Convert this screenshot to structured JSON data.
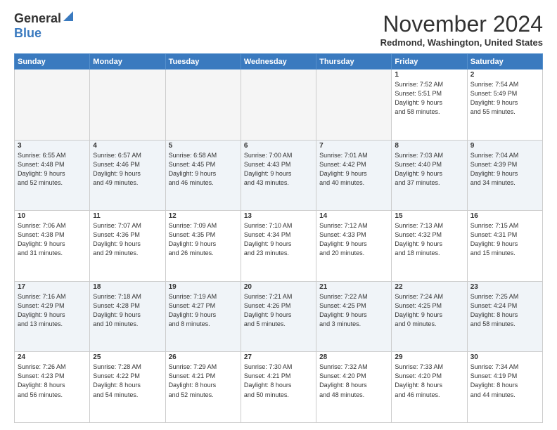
{
  "logo": {
    "line1": "General",
    "line2": "Blue"
  },
  "title": "November 2024",
  "location": "Redmond, Washington, United States",
  "days_of_week": [
    "Sunday",
    "Monday",
    "Tuesday",
    "Wednesday",
    "Thursday",
    "Friday",
    "Saturday"
  ],
  "weeks": [
    [
      {
        "day": "",
        "info": ""
      },
      {
        "day": "",
        "info": ""
      },
      {
        "day": "",
        "info": ""
      },
      {
        "day": "",
        "info": ""
      },
      {
        "day": "",
        "info": ""
      },
      {
        "day": "1",
        "info": "Sunrise: 7:52 AM\nSunset: 5:51 PM\nDaylight: 9 hours\nand 58 minutes."
      },
      {
        "day": "2",
        "info": "Sunrise: 7:54 AM\nSunset: 5:49 PM\nDaylight: 9 hours\nand 55 minutes."
      }
    ],
    [
      {
        "day": "3",
        "info": "Sunrise: 6:55 AM\nSunset: 4:48 PM\nDaylight: 9 hours\nand 52 minutes."
      },
      {
        "day": "4",
        "info": "Sunrise: 6:57 AM\nSunset: 4:46 PM\nDaylight: 9 hours\nand 49 minutes."
      },
      {
        "day": "5",
        "info": "Sunrise: 6:58 AM\nSunset: 4:45 PM\nDaylight: 9 hours\nand 46 minutes."
      },
      {
        "day": "6",
        "info": "Sunrise: 7:00 AM\nSunset: 4:43 PM\nDaylight: 9 hours\nand 43 minutes."
      },
      {
        "day": "7",
        "info": "Sunrise: 7:01 AM\nSunset: 4:42 PM\nDaylight: 9 hours\nand 40 minutes."
      },
      {
        "day": "8",
        "info": "Sunrise: 7:03 AM\nSunset: 4:40 PM\nDaylight: 9 hours\nand 37 minutes."
      },
      {
        "day": "9",
        "info": "Sunrise: 7:04 AM\nSunset: 4:39 PM\nDaylight: 9 hours\nand 34 minutes."
      }
    ],
    [
      {
        "day": "10",
        "info": "Sunrise: 7:06 AM\nSunset: 4:38 PM\nDaylight: 9 hours\nand 31 minutes."
      },
      {
        "day": "11",
        "info": "Sunrise: 7:07 AM\nSunset: 4:36 PM\nDaylight: 9 hours\nand 29 minutes."
      },
      {
        "day": "12",
        "info": "Sunrise: 7:09 AM\nSunset: 4:35 PM\nDaylight: 9 hours\nand 26 minutes."
      },
      {
        "day": "13",
        "info": "Sunrise: 7:10 AM\nSunset: 4:34 PM\nDaylight: 9 hours\nand 23 minutes."
      },
      {
        "day": "14",
        "info": "Sunrise: 7:12 AM\nSunset: 4:33 PM\nDaylight: 9 hours\nand 20 minutes."
      },
      {
        "day": "15",
        "info": "Sunrise: 7:13 AM\nSunset: 4:32 PM\nDaylight: 9 hours\nand 18 minutes."
      },
      {
        "day": "16",
        "info": "Sunrise: 7:15 AM\nSunset: 4:31 PM\nDaylight: 9 hours\nand 15 minutes."
      }
    ],
    [
      {
        "day": "17",
        "info": "Sunrise: 7:16 AM\nSunset: 4:29 PM\nDaylight: 9 hours\nand 13 minutes."
      },
      {
        "day": "18",
        "info": "Sunrise: 7:18 AM\nSunset: 4:28 PM\nDaylight: 9 hours\nand 10 minutes."
      },
      {
        "day": "19",
        "info": "Sunrise: 7:19 AM\nSunset: 4:27 PM\nDaylight: 9 hours\nand 8 minutes."
      },
      {
        "day": "20",
        "info": "Sunrise: 7:21 AM\nSunset: 4:26 PM\nDaylight: 9 hours\nand 5 minutes."
      },
      {
        "day": "21",
        "info": "Sunrise: 7:22 AM\nSunset: 4:25 PM\nDaylight: 9 hours\nand 3 minutes."
      },
      {
        "day": "22",
        "info": "Sunrise: 7:24 AM\nSunset: 4:25 PM\nDaylight: 9 hours\nand 0 minutes."
      },
      {
        "day": "23",
        "info": "Sunrise: 7:25 AM\nSunset: 4:24 PM\nDaylight: 8 hours\nand 58 minutes."
      }
    ],
    [
      {
        "day": "24",
        "info": "Sunrise: 7:26 AM\nSunset: 4:23 PM\nDaylight: 8 hours\nand 56 minutes."
      },
      {
        "day": "25",
        "info": "Sunrise: 7:28 AM\nSunset: 4:22 PM\nDaylight: 8 hours\nand 54 minutes."
      },
      {
        "day": "26",
        "info": "Sunrise: 7:29 AM\nSunset: 4:21 PM\nDaylight: 8 hours\nand 52 minutes."
      },
      {
        "day": "27",
        "info": "Sunrise: 7:30 AM\nSunset: 4:21 PM\nDaylight: 8 hours\nand 50 minutes."
      },
      {
        "day": "28",
        "info": "Sunrise: 7:32 AM\nSunset: 4:20 PM\nDaylight: 8 hours\nand 48 minutes."
      },
      {
        "day": "29",
        "info": "Sunrise: 7:33 AM\nSunset: 4:20 PM\nDaylight: 8 hours\nand 46 minutes."
      },
      {
        "day": "30",
        "info": "Sunrise: 7:34 AM\nSunset: 4:19 PM\nDaylight: 8 hours\nand 44 minutes."
      }
    ]
  ]
}
